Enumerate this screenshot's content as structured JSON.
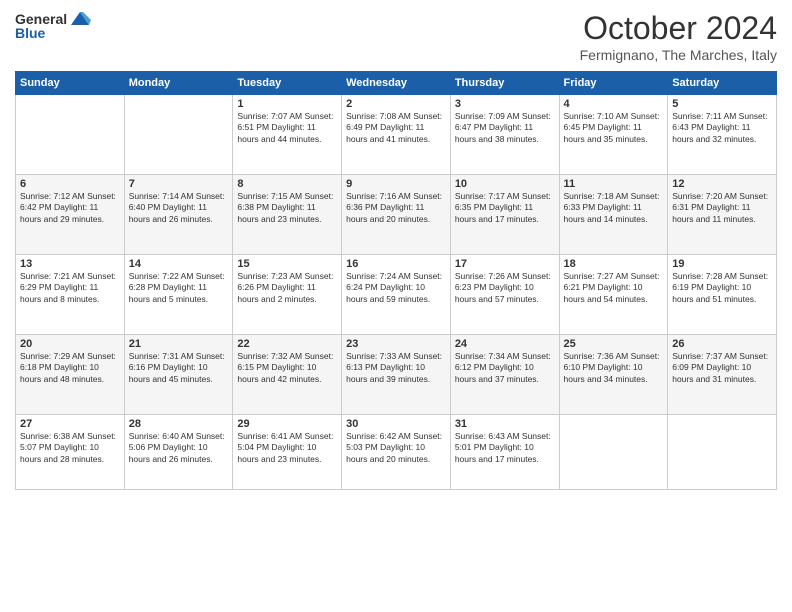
{
  "header": {
    "logo": {
      "general": "General",
      "blue": "Blue"
    },
    "title": "October 2024",
    "subtitle": "Fermignano, The Marches, Italy"
  },
  "days_of_week": [
    "Sunday",
    "Monday",
    "Tuesday",
    "Wednesday",
    "Thursday",
    "Friday",
    "Saturday"
  ],
  "weeks": [
    [
      {
        "day": "",
        "info": ""
      },
      {
        "day": "",
        "info": ""
      },
      {
        "day": "1",
        "info": "Sunrise: 7:07 AM\nSunset: 6:51 PM\nDaylight: 11 hours and 44 minutes."
      },
      {
        "day": "2",
        "info": "Sunrise: 7:08 AM\nSunset: 6:49 PM\nDaylight: 11 hours and 41 minutes."
      },
      {
        "day": "3",
        "info": "Sunrise: 7:09 AM\nSunset: 6:47 PM\nDaylight: 11 hours and 38 minutes."
      },
      {
        "day": "4",
        "info": "Sunrise: 7:10 AM\nSunset: 6:45 PM\nDaylight: 11 hours and 35 minutes."
      },
      {
        "day": "5",
        "info": "Sunrise: 7:11 AM\nSunset: 6:43 PM\nDaylight: 11 hours and 32 minutes."
      }
    ],
    [
      {
        "day": "6",
        "info": "Sunrise: 7:12 AM\nSunset: 6:42 PM\nDaylight: 11 hours and 29 minutes."
      },
      {
        "day": "7",
        "info": "Sunrise: 7:14 AM\nSunset: 6:40 PM\nDaylight: 11 hours and 26 minutes."
      },
      {
        "day": "8",
        "info": "Sunrise: 7:15 AM\nSunset: 6:38 PM\nDaylight: 11 hours and 23 minutes."
      },
      {
        "day": "9",
        "info": "Sunrise: 7:16 AM\nSunset: 6:36 PM\nDaylight: 11 hours and 20 minutes."
      },
      {
        "day": "10",
        "info": "Sunrise: 7:17 AM\nSunset: 6:35 PM\nDaylight: 11 hours and 17 minutes."
      },
      {
        "day": "11",
        "info": "Sunrise: 7:18 AM\nSunset: 6:33 PM\nDaylight: 11 hours and 14 minutes."
      },
      {
        "day": "12",
        "info": "Sunrise: 7:20 AM\nSunset: 6:31 PM\nDaylight: 11 hours and 11 minutes."
      }
    ],
    [
      {
        "day": "13",
        "info": "Sunrise: 7:21 AM\nSunset: 6:29 PM\nDaylight: 11 hours and 8 minutes."
      },
      {
        "day": "14",
        "info": "Sunrise: 7:22 AM\nSunset: 6:28 PM\nDaylight: 11 hours and 5 minutes."
      },
      {
        "day": "15",
        "info": "Sunrise: 7:23 AM\nSunset: 6:26 PM\nDaylight: 11 hours and 2 minutes."
      },
      {
        "day": "16",
        "info": "Sunrise: 7:24 AM\nSunset: 6:24 PM\nDaylight: 10 hours and 59 minutes."
      },
      {
        "day": "17",
        "info": "Sunrise: 7:26 AM\nSunset: 6:23 PM\nDaylight: 10 hours and 57 minutes."
      },
      {
        "day": "18",
        "info": "Sunrise: 7:27 AM\nSunset: 6:21 PM\nDaylight: 10 hours and 54 minutes."
      },
      {
        "day": "19",
        "info": "Sunrise: 7:28 AM\nSunset: 6:19 PM\nDaylight: 10 hours and 51 minutes."
      }
    ],
    [
      {
        "day": "20",
        "info": "Sunrise: 7:29 AM\nSunset: 6:18 PM\nDaylight: 10 hours and 48 minutes."
      },
      {
        "day": "21",
        "info": "Sunrise: 7:31 AM\nSunset: 6:16 PM\nDaylight: 10 hours and 45 minutes."
      },
      {
        "day": "22",
        "info": "Sunrise: 7:32 AM\nSunset: 6:15 PM\nDaylight: 10 hours and 42 minutes."
      },
      {
        "day": "23",
        "info": "Sunrise: 7:33 AM\nSunset: 6:13 PM\nDaylight: 10 hours and 39 minutes."
      },
      {
        "day": "24",
        "info": "Sunrise: 7:34 AM\nSunset: 6:12 PM\nDaylight: 10 hours and 37 minutes."
      },
      {
        "day": "25",
        "info": "Sunrise: 7:36 AM\nSunset: 6:10 PM\nDaylight: 10 hours and 34 minutes."
      },
      {
        "day": "26",
        "info": "Sunrise: 7:37 AM\nSunset: 6:09 PM\nDaylight: 10 hours and 31 minutes."
      }
    ],
    [
      {
        "day": "27",
        "info": "Sunrise: 6:38 AM\nSunset: 5:07 PM\nDaylight: 10 hours and 28 minutes."
      },
      {
        "day": "28",
        "info": "Sunrise: 6:40 AM\nSunset: 5:06 PM\nDaylight: 10 hours and 26 minutes."
      },
      {
        "day": "29",
        "info": "Sunrise: 6:41 AM\nSunset: 5:04 PM\nDaylight: 10 hours and 23 minutes."
      },
      {
        "day": "30",
        "info": "Sunrise: 6:42 AM\nSunset: 5:03 PM\nDaylight: 10 hours and 20 minutes."
      },
      {
        "day": "31",
        "info": "Sunrise: 6:43 AM\nSunset: 5:01 PM\nDaylight: 10 hours and 17 minutes."
      },
      {
        "day": "",
        "info": ""
      },
      {
        "day": "",
        "info": ""
      }
    ]
  ]
}
